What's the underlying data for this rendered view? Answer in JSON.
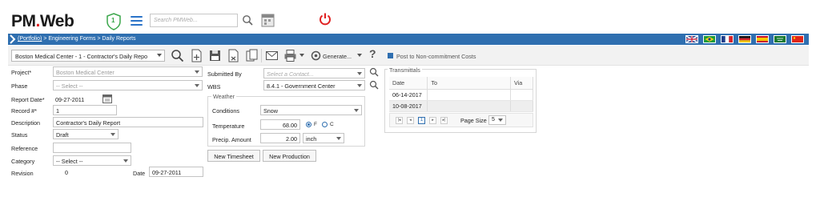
{
  "header": {
    "logo_text_a": "PM",
    "logo_text_b": "Web",
    "shield_count": "1",
    "search_placeholder": "Search PMWeb..."
  },
  "breadcrumb": {
    "portfolio": "(Portfolio)",
    "rest": " > Engineering Forms > Daily Reports"
  },
  "flags": [
    "uk",
    "brazil",
    "france",
    "germany",
    "spain",
    "saudi",
    "china"
  ],
  "toolbar": {
    "project_value": "Boston Medical Center - 1 - Contractor's Daily Repo",
    "generate_label": "Generate...",
    "help_label": "?",
    "post_label": "Post to Non-commitment Costs"
  },
  "form": {
    "project_label": "Project*",
    "project_value": "Boston Medical Center",
    "phase_label": "Phase",
    "phase_value": "-- Select --",
    "report_date_label": "Report Date*",
    "report_date_value": "09-27-2011",
    "record_label": "Record #*",
    "record_value": "1",
    "description_label": "Description",
    "description_value": "Contractor's Daily Report",
    "status_label": "Status",
    "status_value": "Draft",
    "reference_label": "Reference",
    "reference_value": "",
    "category_label": "Category",
    "category_value": "-- Select --",
    "revision_label": "Revision",
    "revision_value": "0",
    "date_label": "Date",
    "date_value": "09-27-2011",
    "submitted_by_label": "Submitted By",
    "submitted_by_placeholder": "Select a Contact...",
    "wbs_label": "WBS",
    "wbs_value": "8.4.1 - Government Center"
  },
  "weather": {
    "title": "Weather",
    "conditions_label": "Conditions",
    "conditions_value": "Snow",
    "temperature_label": "Temperature",
    "temperature_value": "68.00",
    "unit_f": "F",
    "unit_c": "C",
    "precip_label": "Precip. Amount",
    "precip_value": "2.00",
    "precip_unit": "inch"
  },
  "buttons": {
    "new_timesheet": "New Timesheet",
    "new_production": "New Production"
  },
  "transmittals": {
    "title": "Transmittals",
    "columns": [
      "Date",
      "To",
      "Via"
    ],
    "rows": [
      {
        "date": "06-14-2017",
        "to": "",
        "via": ""
      },
      {
        "date": "10-08-2017",
        "to": "",
        "via": ""
      }
    ],
    "page": "1",
    "page_size_label": "Page Size",
    "page_size_value": "5"
  }
}
